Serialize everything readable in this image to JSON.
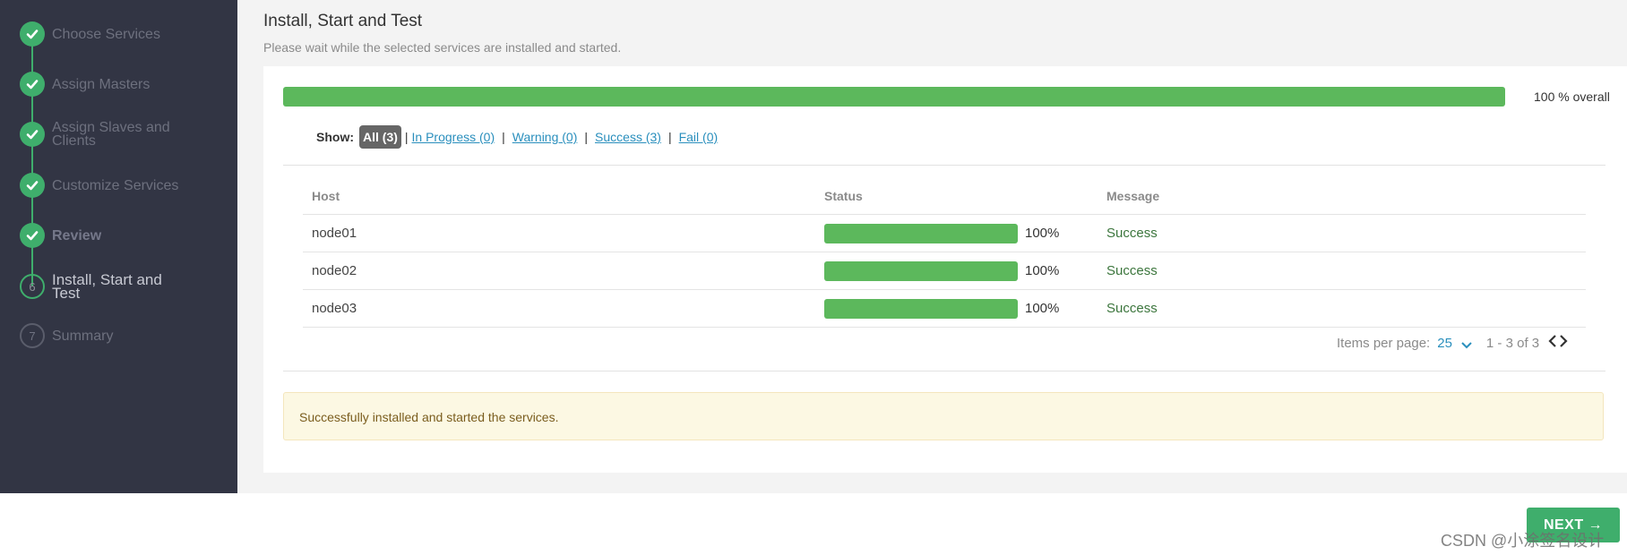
{
  "wizard": {
    "steps": [
      {
        "label": "Choose Services",
        "state": "done"
      },
      {
        "label": "Assign Masters",
        "state": "done"
      },
      {
        "label": "Assign Slaves and Clients",
        "state": "done"
      },
      {
        "label": "Customize Services",
        "state": "done"
      },
      {
        "label": "Review",
        "state": "done"
      },
      {
        "label": "Install, Start and Test",
        "number": "6",
        "state": "current"
      },
      {
        "label": "Summary",
        "number": "7",
        "state": "future"
      }
    ]
  },
  "page": {
    "title": "Install, Start and Test",
    "subtitle": "Please wait while the selected services are installed and started."
  },
  "overall": {
    "progress": 100,
    "label": "100 % overall"
  },
  "filter": {
    "show_label": "Show:",
    "all": "All (3)",
    "in_progress": "In Progress (0)",
    "warning": "Warning (0)",
    "success": "Success (3)",
    "fail": "Fail (0)",
    "separator": "|"
  },
  "table": {
    "headers": {
      "host": "Host",
      "status": "Status",
      "message": "Message"
    },
    "rows": [
      {
        "host": "node01",
        "progress": 100,
        "percent": "100%",
        "message": "Success"
      },
      {
        "host": "node02",
        "progress": 100,
        "percent": "100%",
        "message": "Success"
      },
      {
        "host": "node03",
        "progress": 100,
        "percent": "100%",
        "message": "Success"
      }
    ]
  },
  "pagination": {
    "items_per_page_label": "Items per page:",
    "items_per_page_value": "25",
    "range": "1 - 3 of 3"
  },
  "alert": {
    "message": "Successfully installed and started the services."
  },
  "footer": {
    "next_label": "NEXT →",
    "watermark": "CSDN @小涂签名设计"
  },
  "colors": {
    "sidebar_bg": "#323544",
    "accent_green": "#3fae6c",
    "progress_green": "#5cb85c",
    "link_blue": "#2a8fbd",
    "alert_bg": "#fcf8e3"
  }
}
